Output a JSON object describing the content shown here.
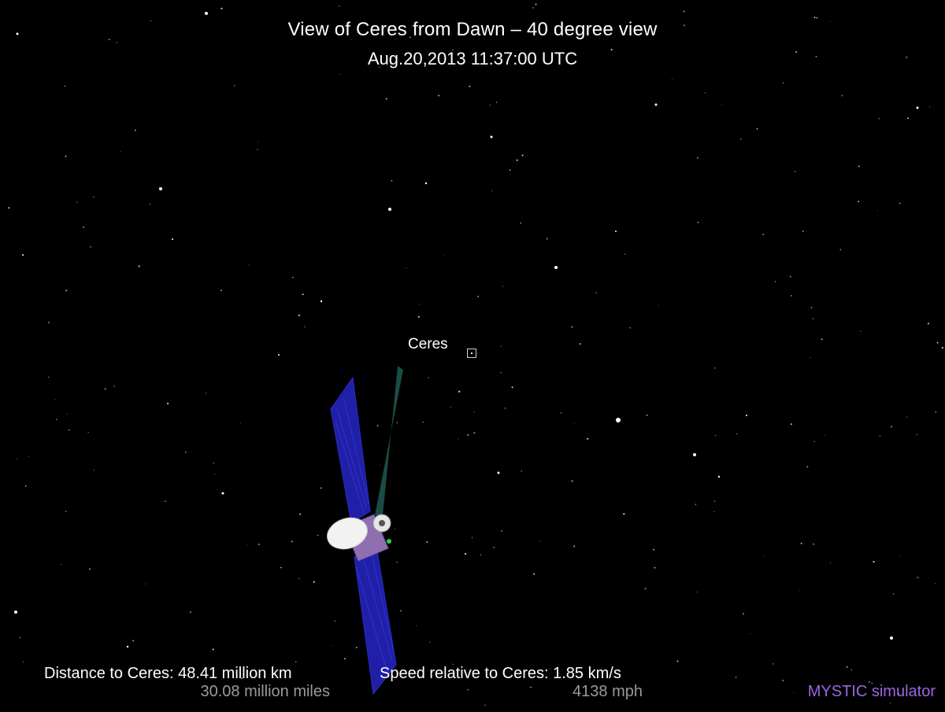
{
  "header": {
    "title": "View of Ceres from Dawn – 40 degree view",
    "timestamp": "Aug.20,2013 11:37:00  UTC"
  },
  "target": {
    "label": "Ceres"
  },
  "readouts": {
    "distance_km": "Distance to Ceres: 48.41 million km",
    "distance_miles": "30.08 million miles",
    "speed_kms": "Speed relative to Ceres: 1.85 km/s",
    "speed_mph": "4138 mph"
  },
  "footer": {
    "simulator": "MYSTIC simulator"
  },
  "colors": {
    "background": "#000000",
    "text": "#ffffff",
    "secondary_text": "#9a9a9a",
    "brand": "#9966e0",
    "solar_panel": "#1f1fa8",
    "bus": "#8e6fb0",
    "antenna": "#f2f2f2",
    "plume": "#39a89a"
  }
}
